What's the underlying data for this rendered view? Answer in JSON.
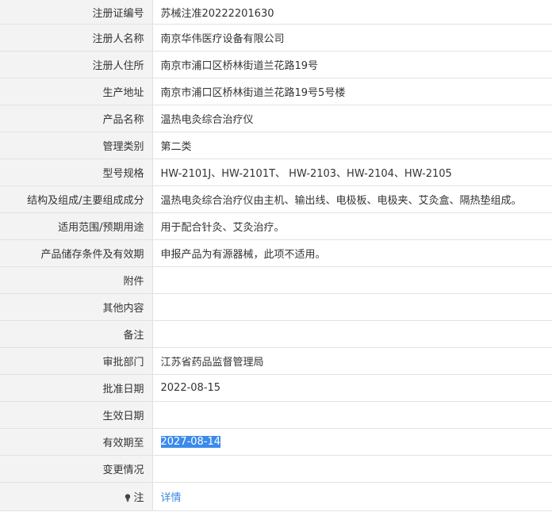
{
  "rows": [
    {
      "label": "注册证编号",
      "value": "苏械注准20222201630"
    },
    {
      "label": "注册人名称",
      "value": "南京华伟医疗设备有限公司"
    },
    {
      "label": "注册人住所",
      "value": "南京市浦口区桥林街道兰花路19号"
    },
    {
      "label": "生产地址",
      "value": "南京市浦口区桥林街道兰花路19号5号楼"
    },
    {
      "label": "产品名称",
      "value": "温热电灸综合治疗仪"
    },
    {
      "label": "管理类别",
      "value": "第二类"
    },
    {
      "label": "型号规格",
      "value": "HW-2101J、HW-2101T、 HW-2103、HW-2104、HW-2105"
    },
    {
      "label": "结构及组成/主要组成成分",
      "value": "温热电灸综合治疗仪由主机、输出线、电极板、电极夹、艾灸盒、隔热垫组成。"
    },
    {
      "label": "适用范围/预期用途",
      "value": "用于配合针灸、艾灸治疗。"
    },
    {
      "label": "产品储存条件及有效期",
      "value": "申报产品为有源器械，此项不适用。"
    },
    {
      "label": "附件",
      "value": ""
    },
    {
      "label": "其他内容",
      "value": ""
    },
    {
      "label": "备注",
      "value": ""
    },
    {
      "label": "审批部门",
      "value": "江苏省药品监督管理局"
    },
    {
      "label": "批准日期",
      "value": "2022-08-15"
    },
    {
      "label": "生效日期",
      "value": ""
    },
    {
      "label": "有效期至",
      "value": "2027-08-14"
    },
    {
      "label": "变更情况",
      "value": ""
    }
  ],
  "note": {
    "label": "注",
    "icon": "lightbulb-icon",
    "link": "详情"
  },
  "colors": {
    "label_bg": "#f3f3f3",
    "border": "#e2e2e2",
    "link": "#3a86e0",
    "selection": "#3b8bea"
  }
}
